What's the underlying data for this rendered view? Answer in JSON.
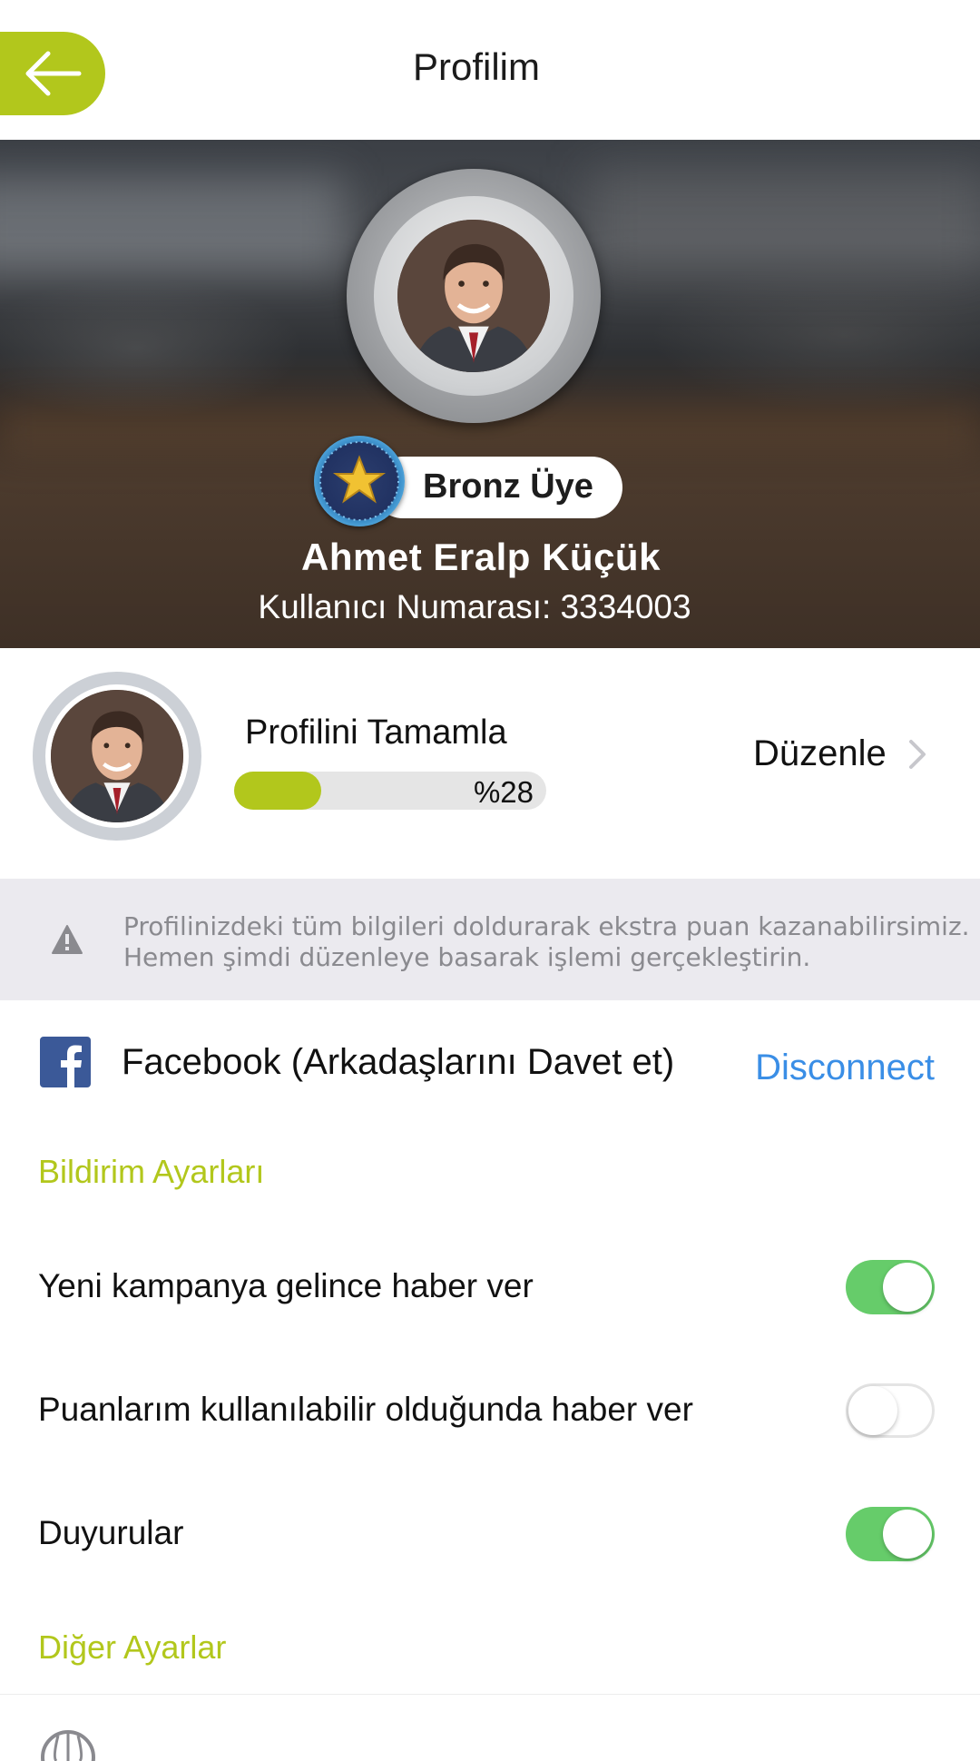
{
  "header": {
    "title": "Profilim",
    "back_icon": "arrow-left-icon"
  },
  "hero": {
    "membership_level": "Bronz Üye",
    "user_name": "Ahmet Eralp Küçük",
    "user_number": "Kullanıcı Numarası: 3334003"
  },
  "profile_completion": {
    "title": "Profilini Tamamla",
    "percent": 28,
    "percent_text": "%28",
    "edit_label": "Düzenle"
  },
  "info_banner": {
    "line1": "Profilinizdeki tüm bilgileri doldurarak ekstra puan kazanabilirsimiz.",
    "line2": "Hemen şimdi düzenleye basarak işlemi gerçekleştirin."
  },
  "facebook": {
    "label": "Facebook  (Arkadaşlarını Davet et)",
    "action": "Disconnect"
  },
  "notification_settings": {
    "section_label": "Bildirim Ayarları",
    "items": [
      {
        "label": "Yeni kampanya gelince haber ver",
        "enabled": true
      },
      {
        "label": "Puanlarım kullanılabilir olduğunda haber ver",
        "enabled": false
      },
      {
        "label": "Duyurular",
        "enabled": true
      }
    ]
  },
  "other_settings": {
    "section_label": "Diğer Ayarlar"
  },
  "colors": {
    "accent": "#b2c71c",
    "toggle_on": "#66cc6a",
    "link": "#3a8ee6",
    "banner_bg": "#ebeaef"
  }
}
